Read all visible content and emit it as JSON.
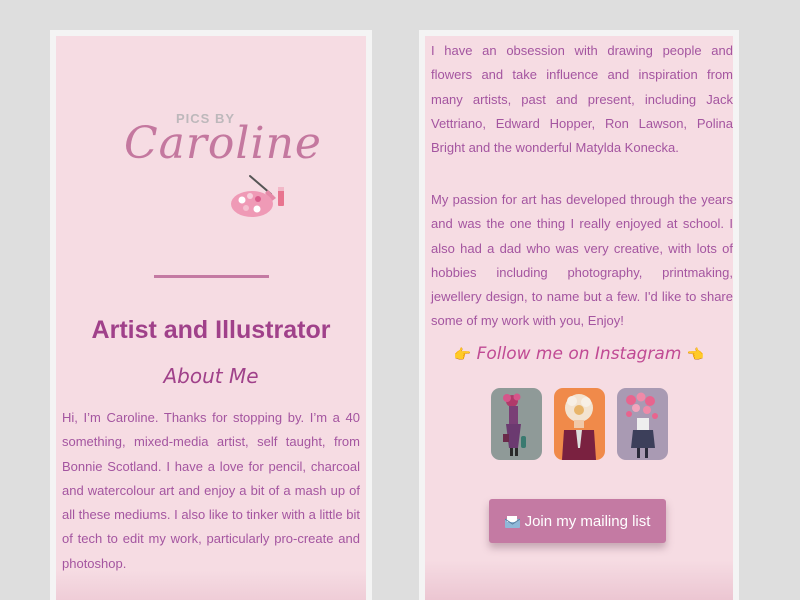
{
  "left_page": {
    "logo": {
      "small_text": "PICS BY",
      "script_text": "Caroline",
      "palette_icon": "paint-palette-icon"
    },
    "headline": "Artist and Illustrator",
    "subhead": "About Me",
    "bio": "Hi, I’m Caroline. Thanks for stopping by. I’m a 40 something, mixed-media artist, self taught, from Bonnie Scotland. I have a love for pencil, charcoal and watercolour art and enjoy a bit of a mash up of all these mediums. I also like to tinker with a little bit of tech to edit my work, particularly pro-create and photoshop."
  },
  "right_page": {
    "paragraph1": "I have an obsession with drawing people and flowers and take influence and inspiration from many artists, past and present, including Jack Vettriano, Edward Hopper, Ron Lawson, Polina Bright and the wonderful Matylda Konecka.",
    "paragraph2": "My passion for art has developed through the years and was the one thing I really enjoyed at school. I also had a dad who was very creative, with lots of hobbies including photography, printmaking, jewellery design, to name but a few. I'd like to share some of my work with you, Enjoy!",
    "instagram": {
      "hand_left": "👉",
      "heading": "Follow me on Instagram",
      "hand_right": "👈",
      "thumbnails": [
        {
          "name": "instagram-thumb-1",
          "bg": "#8f9a98"
        },
        {
          "name": "instagram-thumb-2",
          "bg": "#f08a4a"
        },
        {
          "name": "instagram-thumb-3",
          "bg": "#a99ab3"
        }
      ]
    },
    "mailing_button": {
      "icon": "mailbox-icon",
      "label": "Join my mailing list"
    }
  },
  "colors": {
    "page_bg": "#f6dce3",
    "accent": "#c47aa3",
    "heading": "#a0418a",
    "text": "#a455a0"
  }
}
